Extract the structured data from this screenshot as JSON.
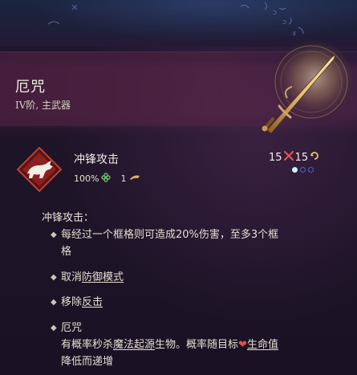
{
  "item": {
    "title": "厄咒",
    "subtitle": "IV阶, 主武器"
  },
  "skill": {
    "name": "冲锋攻击",
    "chance": "100%",
    "count": "1",
    "cost_a": "15",
    "cost_b": "15",
    "pips_filled": 1,
    "pips_total": 3
  },
  "description": {
    "heading": "冲锋攻击：",
    "b1_line1": "每经过一个框格则可造成20%伤害，至多3个框",
    "b1_line2": "格",
    "b2_prefix": "取消",
    "b2_link": "防御模式",
    "b3_prefix": "移除",
    "b3_link": "反击",
    "b4_title": "厄咒",
    "b4_l1_prefix": "有概率秒杀",
    "b4_l1_link": "魔法起源",
    "b4_l1_mid": "生物。概率随目标",
    "b4_l1_link2": "生命值",
    "b4_line2": "降低而递增"
  },
  "icons": {
    "skill": "bull-charge-icon",
    "chance": "clover-icon",
    "count": "horn-icon",
    "cost_a": "crossed-swords-icon",
    "cost_b": "cycle-icon",
    "heart": "heart-icon",
    "weapon": "sword-icon"
  },
  "colors": {
    "accent_gold": "#d9b36a",
    "pip_filled": "#d8ecff",
    "pip_empty": "#4a67c8",
    "heart": "#e0504a"
  }
}
